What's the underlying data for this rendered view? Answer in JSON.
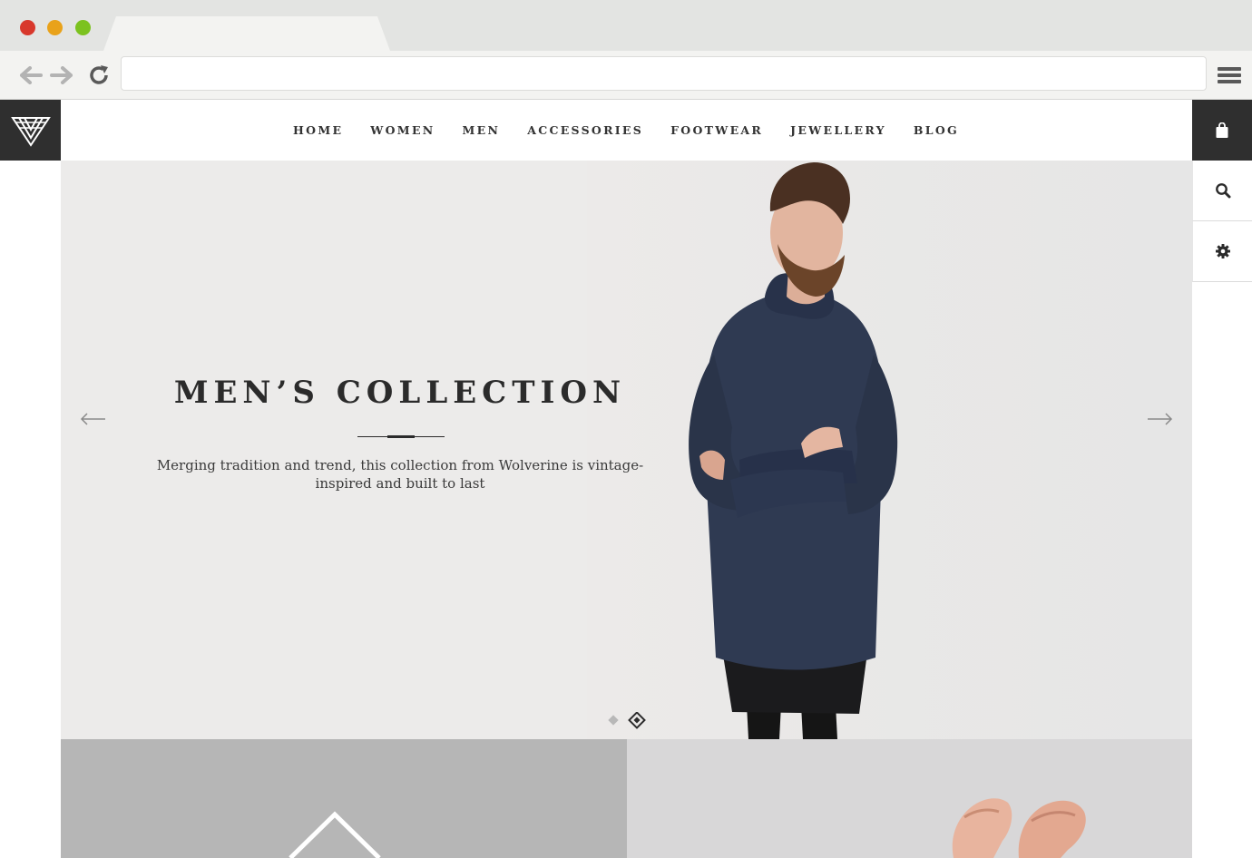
{
  "browser": {
    "url": ""
  },
  "icons": {
    "back": "arrow-left-icon",
    "forward": "arrow-right-icon",
    "reload": "reload-icon",
    "menu": "hamburger-menu-icon",
    "logo": "triangle-logo-icon",
    "cart": "shopping-bag-icon",
    "search": "search-icon",
    "settings": "gear-icon",
    "slide_prev": "arrow-left-icon",
    "slide_next": "arrow-right-icon"
  },
  "nav": {
    "items": [
      {
        "label": "HOME"
      },
      {
        "label": "WOMEN"
      },
      {
        "label": "MEN"
      },
      {
        "label": "ACCESSORIES"
      },
      {
        "label": "FOOTWEAR"
      },
      {
        "label": "JEWELLERY"
      },
      {
        "label": "BLOG"
      }
    ]
  },
  "hero": {
    "title": "MEN’S COLLECTION",
    "description": "Merging tradition and trend, this collection from Wolverine is vintage-inspired and built to last",
    "slide_count": 2,
    "active_slide": 2
  },
  "colors": {
    "dark": "#2f2f2f",
    "hero_bg": "#ecebea",
    "sweater": "#2e3850",
    "tile_left": "#b6b6b6",
    "tile_right": "#d8d7d8"
  }
}
